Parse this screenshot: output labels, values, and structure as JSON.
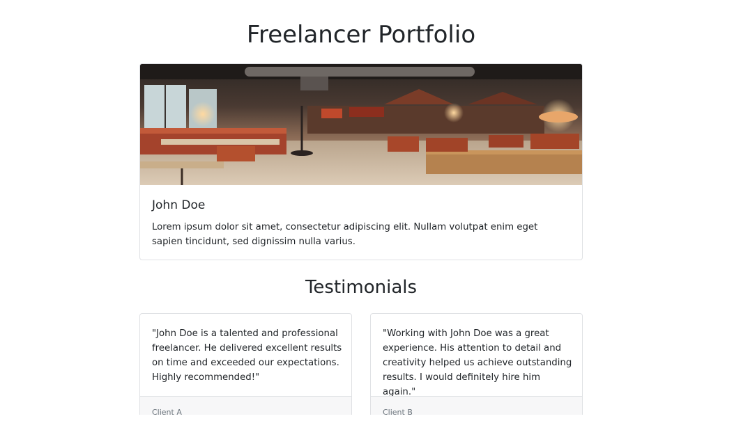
{
  "page": {
    "title": "Freelancer Portfolio"
  },
  "profile": {
    "name": "John Doe",
    "bio": "Lorem ipsum dolor sit amet, consectetur adipiscing elit. Nullam volutpat enim eget sapien tincidunt, sed dignissim nulla varius.",
    "image": "restaurant-interior-photo"
  },
  "testimonials": {
    "title": "Testimonials",
    "items": [
      {
        "text": "\"John Doe is a talented and professional freelancer. He delivered excellent results on time and exceeded our expectations. Highly recommended!\"",
        "client": "Client A"
      },
      {
        "text": "\"Working with John Doe was a great experience. His attention to detail and creativity helped us achieve outstanding results. I would definitely hire him again.\"",
        "client": "Client B"
      }
    ]
  },
  "colors": {
    "text": "#212529",
    "muted": "#6c757d",
    "border": "#dfe1e4",
    "footer_bg": "#f7f7f8"
  }
}
